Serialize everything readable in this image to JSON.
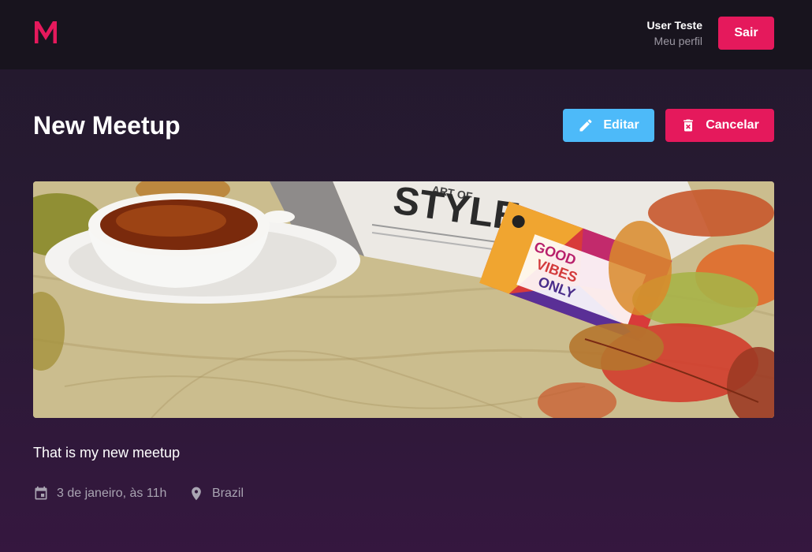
{
  "header": {
    "logo_icon": "meetapp-logo-icon",
    "user_name": "User Teste",
    "profile_link": "Meu perfil",
    "logout_label": "Sair"
  },
  "meetup": {
    "title": "New Meetup",
    "edit_label": "Editar",
    "cancel_label": "Cancelar",
    "banner_alt": "Chá, celular GOOD VIBES ONLY, revista ART OF STYLE e folhas de outono",
    "banner_texts": {
      "magazine": "STYLE",
      "magazine_small": "ART OF",
      "phone_line1": "GOOD",
      "phone_line2": "VIBES",
      "phone_line3": "ONLY"
    },
    "description": "That is my new meetup",
    "date": "3 de janeiro, às 11h",
    "location": "Brazil"
  },
  "colors": {
    "accent_pink": "#e5195c",
    "accent_blue": "#4dbaf9",
    "header_bg": "#18141e"
  },
  "icons": {
    "edit": "pencil-icon",
    "cancel": "trash-icon",
    "date": "calendar-icon",
    "location": "location-pin-icon"
  }
}
